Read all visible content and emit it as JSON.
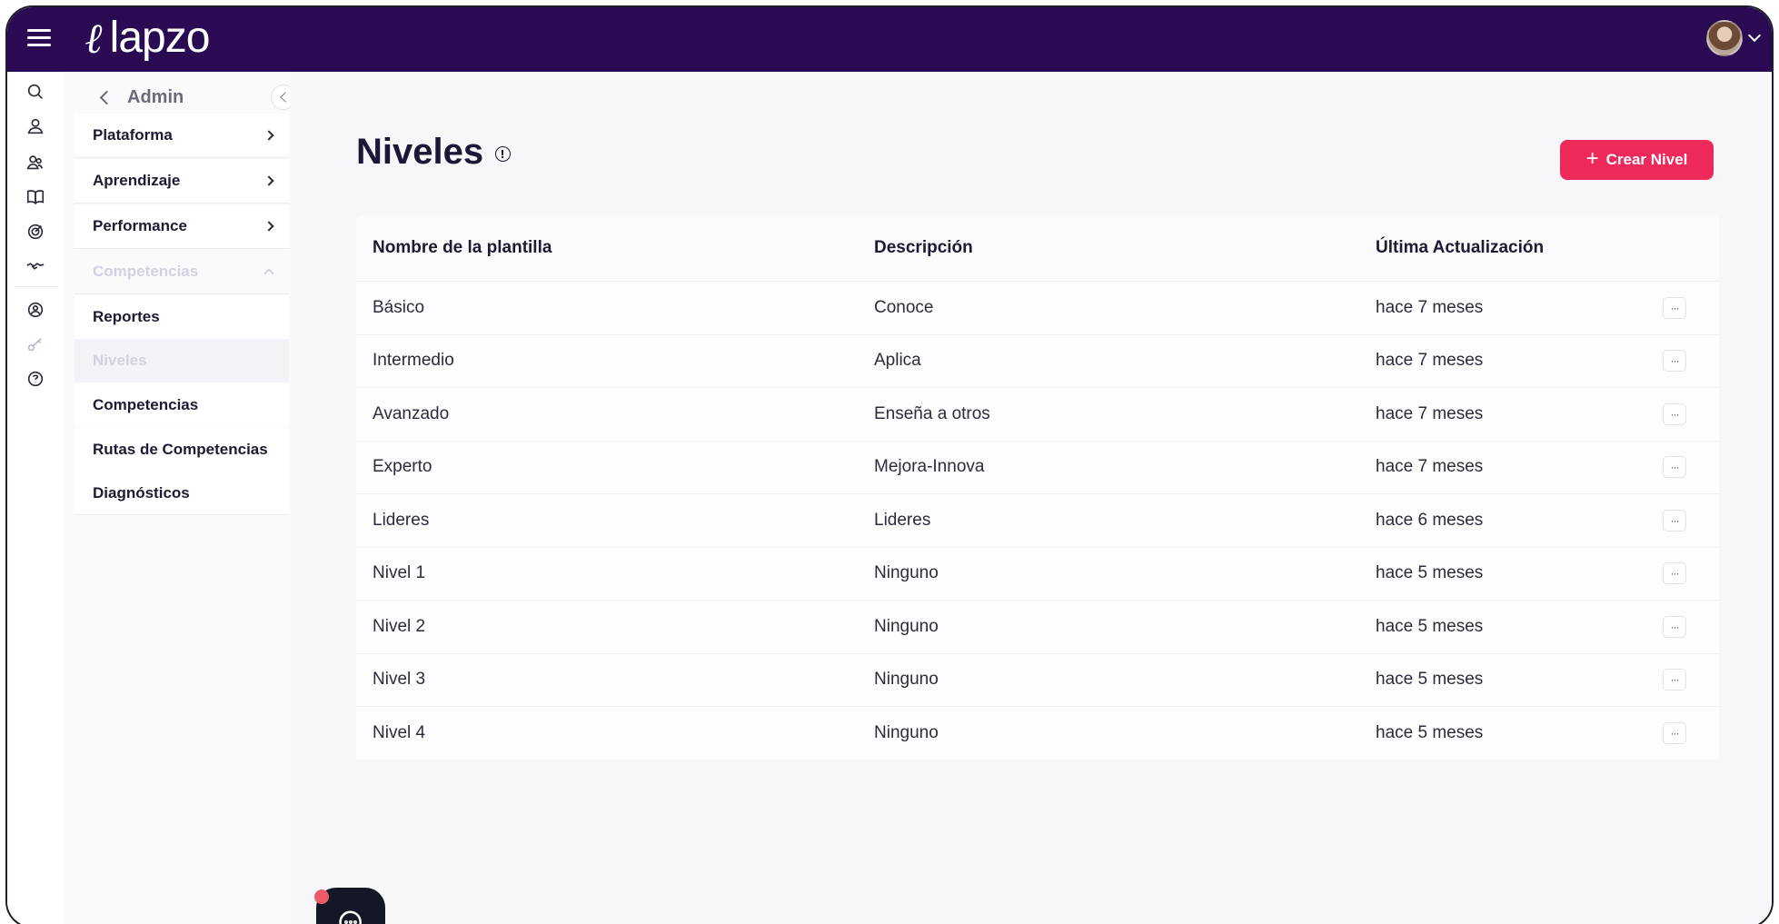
{
  "app": {
    "logo_text": "lapzo",
    "logo_mark": "ℓ"
  },
  "submenu": {
    "title": "Admin",
    "items": [
      {
        "label": "Plataforma"
      },
      {
        "label": "Aprendizaje"
      },
      {
        "label": "Performance"
      },
      {
        "label": "Competencias"
      }
    ],
    "subitems": [
      {
        "label": "Reportes"
      },
      {
        "label": "Niveles"
      },
      {
        "label": "Competencias"
      },
      {
        "label": "Rutas de Competencias"
      },
      {
        "label": "Diagnósticos"
      }
    ]
  },
  "page": {
    "title": "Niveles",
    "create_button": "Crear Nivel"
  },
  "table": {
    "headers": [
      "Nombre de la plantilla",
      "Descripción",
      "Última Actualización"
    ],
    "rows": [
      [
        "Básico",
        "Conoce",
        "hace 7 meses"
      ],
      [
        "Intermedio",
        "Aplica",
        "hace 7 meses"
      ],
      [
        "Avanzado",
        "Enseña a otros",
        "hace 7 meses"
      ],
      [
        "Experto",
        "Mejora-Innova",
        "hace 7 meses"
      ],
      [
        "Lideres",
        "Lideres",
        "hace 6 meses"
      ],
      [
        "Nivel 1",
        "Ninguno",
        "hace 5 meses"
      ],
      [
        "Nivel 2",
        "Ninguno",
        "hace 5 meses"
      ],
      [
        "Nivel 3",
        "Ninguno",
        "hace 5 meses"
      ],
      [
        "Nivel 4",
        "Ninguno",
        "hace 5 meses"
      ]
    ],
    "row_action_glyph": "···"
  },
  "colors": {
    "topbar": "#2a0a52",
    "accent": "#ee2a5a",
    "chat_button": "#141826"
  },
  "icons": {
    "rail": [
      "search-icon",
      "user-icon",
      "users-icon",
      "book-icon",
      "target-icon",
      "handshake-icon",
      "network-icon",
      "key-icon",
      "help-icon"
    ]
  }
}
